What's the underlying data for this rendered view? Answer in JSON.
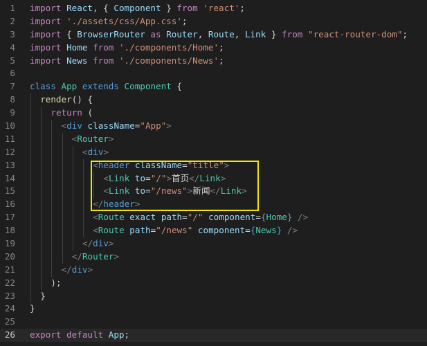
{
  "editor": {
    "language": "javascript",
    "current_line": 26,
    "highlight": {
      "from_line": 13,
      "to_line": 16,
      "color": "#f2e600"
    },
    "colors": {
      "keyword": "#c586c0",
      "storage": "#569cd6",
      "identifier": "#9cdcfe",
      "class_name": "#4ec9b0",
      "string": "#ce9178",
      "function": "#dcdcaa",
      "plain": "#d4d4d4",
      "tag": "#569cd6",
      "bracket": "#808080",
      "line_number": "#858585",
      "background": "#1e1e1e"
    },
    "lines": [
      {
        "n": "1",
        "indent": 0,
        "tokens": [
          {
            "t": "import",
            "c": "keyword"
          },
          {
            "t": " ",
            "c": "plain"
          },
          {
            "t": "React",
            "c": "identifier"
          },
          {
            "t": ", { ",
            "c": "plain"
          },
          {
            "t": "Component",
            "c": "identifier"
          },
          {
            "t": " } ",
            "c": "plain"
          },
          {
            "t": "from",
            "c": "keyword"
          },
          {
            "t": " ",
            "c": "plain"
          },
          {
            "t": "'react'",
            "c": "string"
          },
          {
            "t": ";",
            "c": "plain"
          }
        ]
      },
      {
        "n": "2",
        "indent": 0,
        "tokens": [
          {
            "t": "import",
            "c": "keyword"
          },
          {
            "t": " ",
            "c": "plain"
          },
          {
            "t": "'./assets/css/App.css'",
            "c": "string"
          },
          {
            "t": ";",
            "c": "plain"
          }
        ]
      },
      {
        "n": "3",
        "indent": 0,
        "tokens": [
          {
            "t": "import",
            "c": "keyword"
          },
          {
            "t": " { ",
            "c": "plain"
          },
          {
            "t": "BrowserRouter",
            "c": "identifier"
          },
          {
            "t": " ",
            "c": "plain"
          },
          {
            "t": "as",
            "c": "keyword"
          },
          {
            "t": " ",
            "c": "plain"
          },
          {
            "t": "Router",
            "c": "identifier"
          },
          {
            "t": ", ",
            "c": "plain"
          },
          {
            "t": "Route",
            "c": "identifier"
          },
          {
            "t": ", ",
            "c": "plain"
          },
          {
            "t": "Link",
            "c": "identifier"
          },
          {
            "t": " } ",
            "c": "plain"
          },
          {
            "t": "from",
            "c": "keyword"
          },
          {
            "t": " ",
            "c": "plain"
          },
          {
            "t": "\"react-router-dom\"",
            "c": "string"
          },
          {
            "t": ";",
            "c": "plain"
          }
        ]
      },
      {
        "n": "4",
        "indent": 0,
        "tokens": [
          {
            "t": "import",
            "c": "keyword"
          },
          {
            "t": " ",
            "c": "plain"
          },
          {
            "t": "Home",
            "c": "identifier"
          },
          {
            "t": " ",
            "c": "plain"
          },
          {
            "t": "from",
            "c": "keyword"
          },
          {
            "t": " ",
            "c": "plain"
          },
          {
            "t": "'./components/Home'",
            "c": "string"
          },
          {
            "t": ";",
            "c": "plain"
          }
        ]
      },
      {
        "n": "5",
        "indent": 0,
        "tokens": [
          {
            "t": "import",
            "c": "keyword"
          },
          {
            "t": " ",
            "c": "plain"
          },
          {
            "t": "News",
            "c": "identifier"
          },
          {
            "t": " ",
            "c": "plain"
          },
          {
            "t": "from",
            "c": "keyword"
          },
          {
            "t": " ",
            "c": "plain"
          },
          {
            "t": "'./components/News'",
            "c": "string"
          },
          {
            "t": ";",
            "c": "plain"
          }
        ]
      },
      {
        "n": "6",
        "indent": 0,
        "tokens": []
      },
      {
        "n": "7",
        "indent": 0,
        "tokens": [
          {
            "t": "class",
            "c": "storage"
          },
          {
            "t": " ",
            "c": "plain"
          },
          {
            "t": "App",
            "c": "class_name"
          },
          {
            "t": " ",
            "c": "plain"
          },
          {
            "t": "extends",
            "c": "storage"
          },
          {
            "t": " ",
            "c": "plain"
          },
          {
            "t": "Component",
            "c": "class_name"
          },
          {
            "t": " {",
            "c": "plain"
          }
        ]
      },
      {
        "n": "8",
        "indent": 1,
        "tokens": [
          {
            "t": "render",
            "c": "function"
          },
          {
            "t": "() {",
            "c": "plain"
          }
        ]
      },
      {
        "n": "9",
        "indent": 2,
        "tokens": [
          {
            "t": "return",
            "c": "keyword"
          },
          {
            "t": " (",
            "c": "plain"
          }
        ]
      },
      {
        "n": "10",
        "indent": 3,
        "tokens": [
          {
            "t": "<",
            "c": "bracket"
          },
          {
            "t": "div",
            "c": "tag"
          },
          {
            "t": " ",
            "c": "plain"
          },
          {
            "t": "className",
            "c": "identifier"
          },
          {
            "t": "=",
            "c": "plain"
          },
          {
            "t": "\"App\"",
            "c": "string"
          },
          {
            "t": ">",
            "c": "bracket"
          }
        ]
      },
      {
        "n": "11",
        "indent": 4,
        "tokens": [
          {
            "t": "<",
            "c": "bracket"
          },
          {
            "t": "Router",
            "c": "class_name"
          },
          {
            "t": ">",
            "c": "bracket"
          }
        ]
      },
      {
        "n": "12",
        "indent": 5,
        "tokens": [
          {
            "t": "<",
            "c": "bracket"
          },
          {
            "t": "div",
            "c": "tag"
          },
          {
            "t": ">",
            "c": "bracket"
          }
        ]
      },
      {
        "n": "13",
        "indent": 6,
        "tokens": [
          {
            "t": "<",
            "c": "bracket"
          },
          {
            "t": "header",
            "c": "tag"
          },
          {
            "t": " ",
            "c": "plain"
          },
          {
            "t": "className",
            "c": "identifier"
          },
          {
            "t": "=",
            "c": "plain"
          },
          {
            "t": "\"title\"",
            "c": "string"
          },
          {
            "t": ">",
            "c": "bracket"
          }
        ]
      },
      {
        "n": "14",
        "indent": 7,
        "tokens": [
          {
            "t": "<",
            "c": "bracket"
          },
          {
            "t": "Link",
            "c": "class_name"
          },
          {
            "t": " ",
            "c": "plain"
          },
          {
            "t": "to",
            "c": "identifier"
          },
          {
            "t": "=",
            "c": "plain"
          },
          {
            "t": "\"/\"",
            "c": "string"
          },
          {
            "t": ">",
            "c": "bracket"
          },
          {
            "t": "首页",
            "c": "plain",
            "cjk": true
          },
          {
            "t": "</",
            "c": "bracket"
          },
          {
            "t": "Link",
            "c": "class_name"
          },
          {
            "t": ">",
            "c": "bracket"
          }
        ]
      },
      {
        "n": "15",
        "indent": 7,
        "tokens": [
          {
            "t": "<",
            "c": "bracket"
          },
          {
            "t": "Link",
            "c": "class_name"
          },
          {
            "t": " ",
            "c": "plain"
          },
          {
            "t": "to",
            "c": "identifier"
          },
          {
            "t": "=",
            "c": "plain"
          },
          {
            "t": "\"/news\"",
            "c": "string"
          },
          {
            "t": ">",
            "c": "bracket"
          },
          {
            "t": "新闻",
            "c": "plain",
            "cjk": true
          },
          {
            "t": "</",
            "c": "bracket"
          },
          {
            "t": "Link",
            "c": "class_name"
          },
          {
            "t": ">",
            "c": "bracket"
          }
        ]
      },
      {
        "n": "16",
        "indent": 6,
        "tokens": [
          {
            "t": "</",
            "c": "bracket"
          },
          {
            "t": "header",
            "c": "tag"
          },
          {
            "t": ">",
            "c": "bracket"
          }
        ]
      },
      {
        "n": "17",
        "indent": 6,
        "tokens": [
          {
            "t": "<",
            "c": "bracket"
          },
          {
            "t": "Route",
            "c": "class_name"
          },
          {
            "t": " ",
            "c": "plain"
          },
          {
            "t": "exact",
            "c": "identifier"
          },
          {
            "t": " ",
            "c": "plain"
          },
          {
            "t": "path",
            "c": "identifier"
          },
          {
            "t": "=",
            "c": "plain"
          },
          {
            "t": "\"/\"",
            "c": "string"
          },
          {
            "t": " ",
            "c": "plain"
          },
          {
            "t": "component",
            "c": "identifier"
          },
          {
            "t": "=",
            "c": "plain"
          },
          {
            "t": "{",
            "c": "storage"
          },
          {
            "t": "Home",
            "c": "class_name"
          },
          {
            "t": "}",
            "c": "storage"
          },
          {
            "t": " />",
            "c": "bracket"
          }
        ]
      },
      {
        "n": "18",
        "indent": 6,
        "tokens": [
          {
            "t": "<",
            "c": "bracket"
          },
          {
            "t": "Route",
            "c": "class_name"
          },
          {
            "t": " ",
            "c": "plain"
          },
          {
            "t": "path",
            "c": "identifier"
          },
          {
            "t": "=",
            "c": "plain"
          },
          {
            "t": "\"/news\"",
            "c": "string"
          },
          {
            "t": " ",
            "c": "plain"
          },
          {
            "t": "component",
            "c": "identifier"
          },
          {
            "t": "=",
            "c": "plain"
          },
          {
            "t": "{",
            "c": "storage"
          },
          {
            "t": "News",
            "c": "class_name"
          },
          {
            "t": "}",
            "c": "storage"
          },
          {
            "t": " />",
            "c": "bracket"
          }
        ]
      },
      {
        "n": "19",
        "indent": 5,
        "tokens": [
          {
            "t": "</",
            "c": "bracket"
          },
          {
            "t": "div",
            "c": "tag"
          },
          {
            "t": ">",
            "c": "bracket"
          }
        ]
      },
      {
        "n": "20",
        "indent": 4,
        "tokens": [
          {
            "t": "</",
            "c": "bracket"
          },
          {
            "t": "Router",
            "c": "class_name"
          },
          {
            "t": ">",
            "c": "bracket"
          }
        ]
      },
      {
        "n": "21",
        "indent": 3,
        "tokens": [
          {
            "t": "</",
            "c": "bracket"
          },
          {
            "t": "div",
            "c": "tag"
          },
          {
            "t": ">",
            "c": "bracket"
          }
        ]
      },
      {
        "n": "22",
        "indent": 2,
        "tokens": [
          {
            "t": ");",
            "c": "plain"
          }
        ]
      },
      {
        "n": "23",
        "indent": 1,
        "tokens": [
          {
            "t": "}",
            "c": "plain"
          }
        ]
      },
      {
        "n": "24",
        "indent": 0,
        "tokens": [
          {
            "t": "}",
            "c": "plain"
          }
        ]
      },
      {
        "n": "25",
        "indent": 0,
        "tokens": []
      },
      {
        "n": "26",
        "indent": 0,
        "tokens": [
          {
            "t": "export",
            "c": "keyword"
          },
          {
            "t": " ",
            "c": "plain"
          },
          {
            "t": "default",
            "c": "keyword"
          },
          {
            "t": " ",
            "c": "plain"
          },
          {
            "t": "App",
            "c": "identifier"
          },
          {
            "t": ";",
            "c": "plain"
          }
        ]
      }
    ]
  }
}
